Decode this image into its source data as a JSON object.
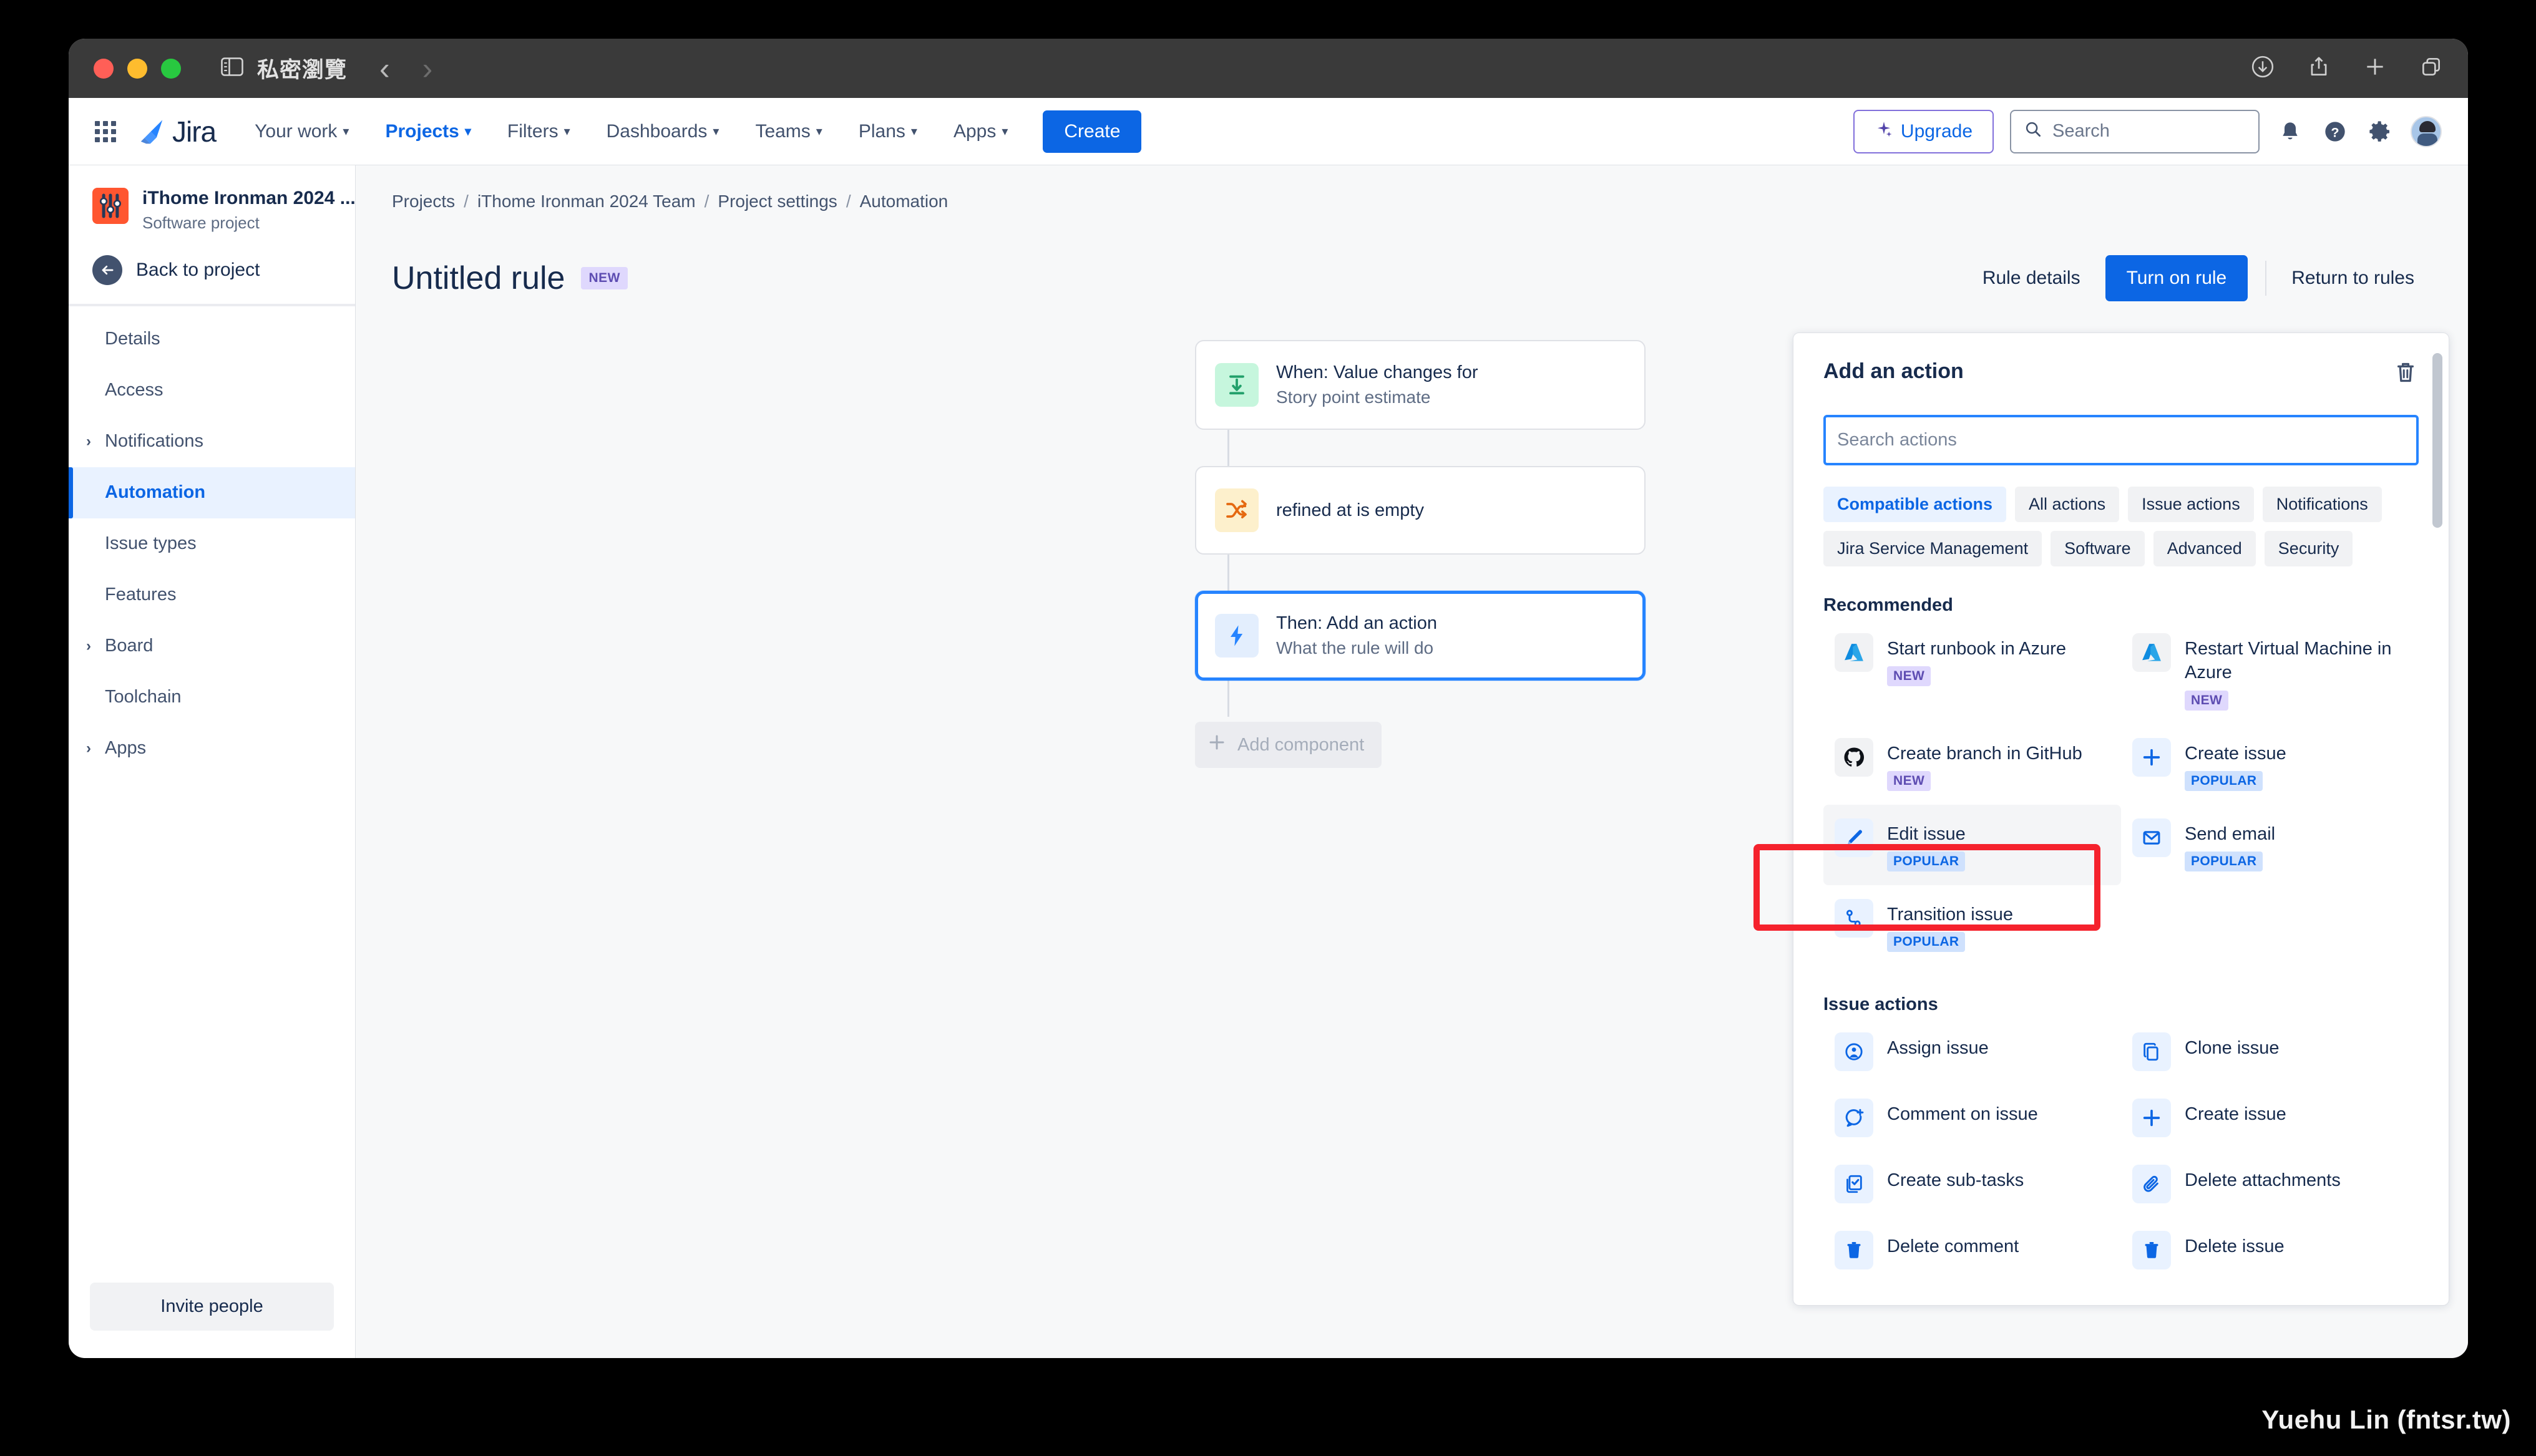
{
  "browser": {
    "private_label": "私密瀏覽",
    "back_arrow": "‹",
    "forward_arrow": "›",
    "icons": [
      "sidebar-icon",
      "downloads-icon",
      "share-icon",
      "new-tab-icon",
      "tab-overview-icon"
    ]
  },
  "topnav": {
    "logo_text": "Jira",
    "items": [
      {
        "label": "Your work",
        "has_caret": true,
        "active": false
      },
      {
        "label": "Projects",
        "has_caret": true,
        "active": true
      },
      {
        "label": "Filters",
        "has_caret": true,
        "active": false
      },
      {
        "label": "Dashboards",
        "has_caret": true,
        "active": false
      },
      {
        "label": "Teams",
        "has_caret": true,
        "active": false
      },
      {
        "label": "Plans",
        "has_caret": true,
        "active": false
      },
      {
        "label": "Apps",
        "has_caret": true,
        "active": false
      }
    ],
    "create_label": "Create",
    "upgrade_label": "Upgrade",
    "search_placeholder": "Search"
  },
  "sidebar": {
    "project_name": "iThome Ironman 2024 ...",
    "project_type": "Software project",
    "back_label": "Back to project",
    "items": [
      {
        "label": "Details",
        "expandable": false,
        "selected": false
      },
      {
        "label": "Access",
        "expandable": false,
        "selected": false
      },
      {
        "label": "Notifications",
        "expandable": true,
        "selected": false
      },
      {
        "label": "Automation",
        "expandable": false,
        "selected": true
      },
      {
        "label": "Issue types",
        "expandable": false,
        "selected": false
      },
      {
        "label": "Features",
        "expandable": false,
        "selected": false
      },
      {
        "label": "Board",
        "expandable": true,
        "selected": false
      },
      {
        "label": "Toolchain",
        "expandable": false,
        "selected": false
      },
      {
        "label": "Apps",
        "expandable": true,
        "selected": false
      }
    ],
    "invite_label": "Invite people"
  },
  "breadcrumb": [
    "Projects",
    "iThome Ironman 2024 Team",
    "Project settings",
    "Automation"
  ],
  "page": {
    "title": "Untitled rule",
    "badge": "NEW",
    "rule_details_label": "Rule details",
    "turn_on_label": "Turn on rule",
    "return_label": "Return to rules"
  },
  "rule_canvas": {
    "cards": [
      {
        "title": "When: Value changes for",
        "subtitle": "Story point estimate",
        "icon": "value-changes-icon",
        "icon_tone": "green",
        "selected": false
      },
      {
        "title": "refined at is empty",
        "subtitle": "",
        "icon": "condition-shuffle-icon",
        "icon_tone": "orange",
        "selected": false
      },
      {
        "title": "Then: Add an action",
        "subtitle": "What the rule will do",
        "icon": "lightning-bolt-icon",
        "icon_tone": "blue",
        "selected": true
      }
    ],
    "add_component_label": "Add component"
  },
  "action_panel": {
    "title": "Add an action",
    "search_placeholder": "Search actions",
    "chips": [
      {
        "label": "Compatible actions",
        "active": true
      },
      {
        "label": "All actions",
        "active": false
      },
      {
        "label": "Issue actions",
        "active": false
      },
      {
        "label": "Notifications",
        "active": false
      },
      {
        "label": "Jira Service Management",
        "active": false
      },
      {
        "label": "Software",
        "active": false
      },
      {
        "label": "Advanced",
        "active": false
      },
      {
        "label": "Security",
        "active": false
      }
    ],
    "sections": [
      {
        "title": "Recommended",
        "items": [
          {
            "label": "Start runbook in Azure",
            "badge": "NEW",
            "badge_kind": "new",
            "icon": "azure-icon",
            "icon_tone": "softgray",
            "hovered": false
          },
          {
            "label": "Restart Virtual Machine in Azure",
            "badge": "NEW",
            "badge_kind": "new",
            "icon": "azure-icon",
            "icon_tone": "softgray",
            "hovered": false
          },
          {
            "label": "Create branch in GitHub",
            "badge": "NEW",
            "badge_kind": "new",
            "icon": "github-icon",
            "icon_tone": "softgray",
            "hovered": false
          },
          {
            "label": "Create issue",
            "badge": "POPULAR",
            "badge_kind": "popular",
            "icon": "plus-icon",
            "icon_tone": "softblue",
            "hovered": false
          },
          {
            "label": "Edit issue",
            "badge": "POPULAR",
            "badge_kind": "popular",
            "icon": "pencil-icon",
            "icon_tone": "softblue",
            "hovered": true
          },
          {
            "label": "Send email",
            "badge": "POPULAR",
            "badge_kind": "popular",
            "icon": "envelope-icon",
            "icon_tone": "softblue",
            "hovered": false
          },
          {
            "label": "Transition issue",
            "badge": "POPULAR",
            "badge_kind": "popular",
            "icon": "transition-icon",
            "icon_tone": "softblue",
            "hovered": false
          }
        ]
      },
      {
        "title": "Issue actions",
        "items": [
          {
            "label": "Assign issue",
            "badge": "",
            "badge_kind": "",
            "icon": "assign-user-icon",
            "icon_tone": "softblue",
            "hovered": false
          },
          {
            "label": "Clone issue",
            "badge": "",
            "badge_kind": "",
            "icon": "clone-icon",
            "icon_tone": "softblue",
            "hovered": false
          },
          {
            "label": "Comment on issue",
            "badge": "",
            "badge_kind": "",
            "icon": "comment-add-icon",
            "icon_tone": "softblue",
            "hovered": false
          },
          {
            "label": "Create issue",
            "badge": "",
            "badge_kind": "",
            "icon": "plus-icon",
            "icon_tone": "softblue",
            "hovered": false
          },
          {
            "label": "Create sub-tasks",
            "badge": "",
            "badge_kind": "",
            "icon": "subtasks-icon",
            "icon_tone": "softblue",
            "hovered": false
          },
          {
            "label": "Delete attachments",
            "badge": "",
            "badge_kind": "",
            "icon": "paperclip-icon",
            "icon_tone": "softblue",
            "hovered": false
          },
          {
            "label": "Delete comment",
            "badge": "",
            "badge_kind": "",
            "icon": "trash-icon",
            "icon_tone": "softblue",
            "hovered": false
          },
          {
            "label": "Delete issue",
            "badge": "",
            "badge_kind": "",
            "icon": "trash-icon",
            "icon_tone": "softblue",
            "hovered": false
          }
        ]
      }
    ]
  },
  "watermark": "Yuehu Lin (fntsr.tw)",
  "colors": {
    "brand_blue": "#0c66e4",
    "selected_border": "#2684ff",
    "highlight_red": "#f5222d",
    "badge_new_bg": "#dfd8fd",
    "badge_new_fg": "#5e4db2",
    "badge_popular_bg": "#cfe1fd",
    "badge_popular_fg": "#0c66e4",
    "project_avatar": "#ff5630"
  }
}
